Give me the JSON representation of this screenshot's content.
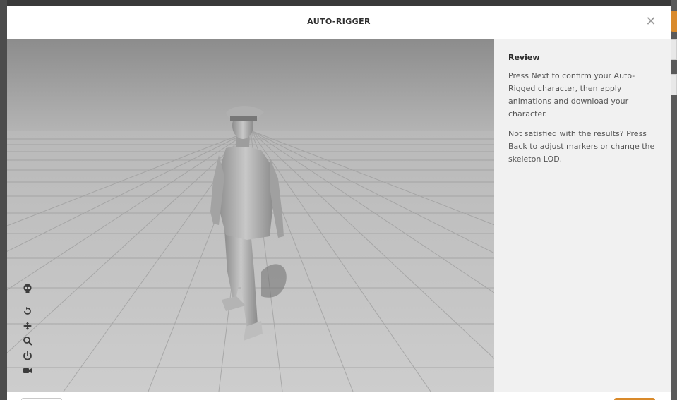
{
  "modal": {
    "title": "AUTO-RIGGER",
    "close_icon": "close-icon"
  },
  "panel": {
    "heading": "Review",
    "paragraph1": "Press Next to confirm your Auto-Rigged character, then apply animations and download your character.",
    "paragraph2": "Not satisfied with the results? Press Back to adjust markers or change the skeleton LOD."
  },
  "viewport": {
    "tools": [
      "skull-icon",
      "rotate-icon",
      "move-icon",
      "zoom-icon",
      "power-icon",
      "camera-icon"
    ]
  },
  "footer": {
    "back_label": "",
    "next_label": ""
  },
  "colors": {
    "accent": "#d98a2b",
    "panel_bg": "#f1f1f1",
    "floor": "#c4c4c4"
  }
}
